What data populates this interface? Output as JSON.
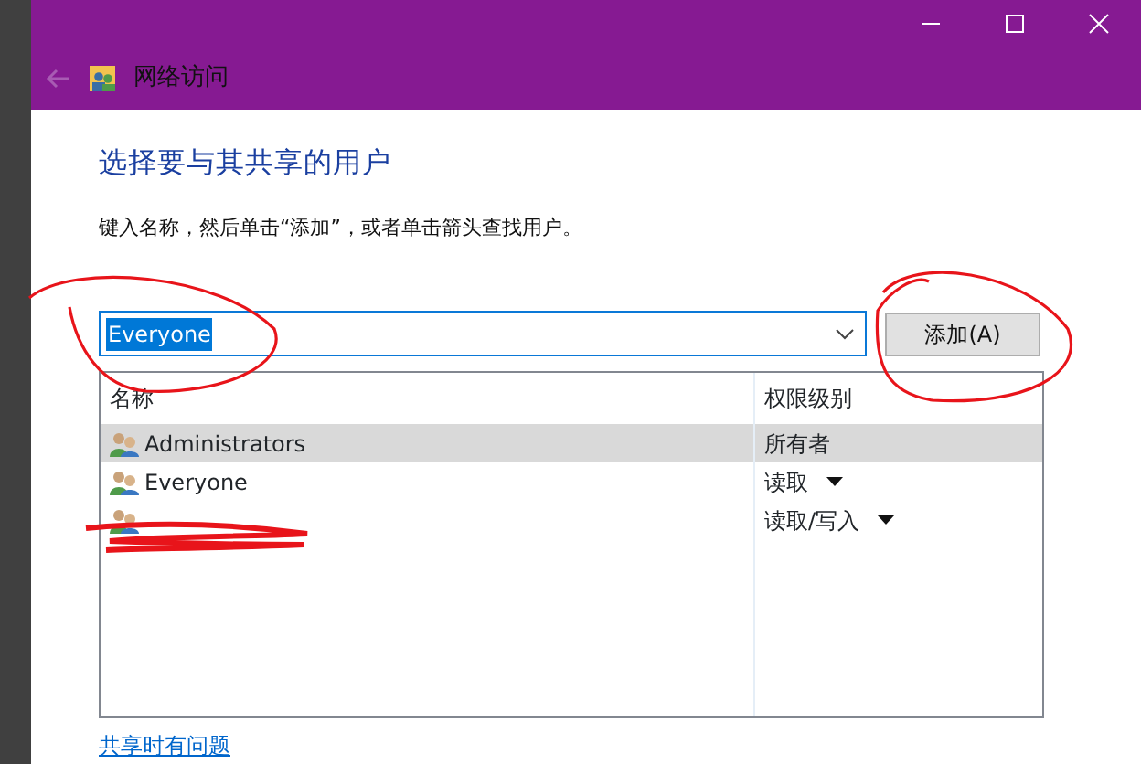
{
  "window": {
    "title": "网络访问"
  },
  "heading": "选择要与其共享的用户",
  "instruction": "键入名称，然后单击“添加”，或者单击箭头查找用户。",
  "name_combo": {
    "value": "Everyone",
    "text_selected": true
  },
  "add_button": "添加(A)",
  "table": {
    "columns": [
      "名称",
      "权限级别"
    ],
    "rows": [
      {
        "name": "Administrators",
        "permission": "所有者",
        "has_dropdown": false,
        "selected": true
      },
      {
        "name": "Everyone",
        "permission": "读取",
        "has_dropdown": true,
        "selected": false
      },
      {
        "permission": "读取/写入",
        "has_dropdown": true,
        "selected": false
      }
    ]
  },
  "help_link": "共享时有问题"
}
